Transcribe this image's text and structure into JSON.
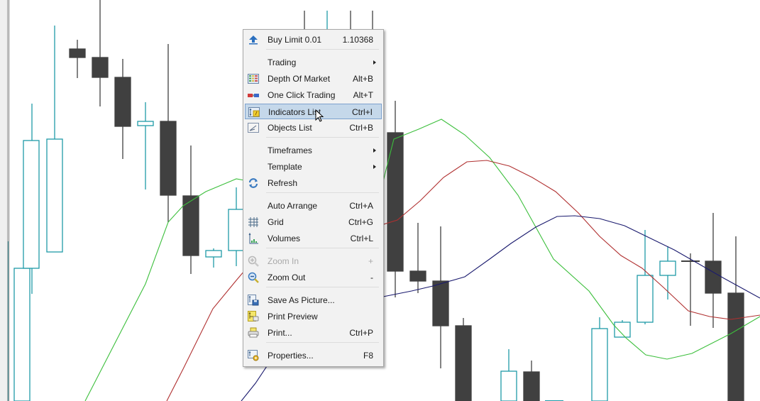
{
  "context_menu": {
    "items": [
      {
        "id": "buy-limit",
        "label": "Buy Limit 0.01",
        "shortcut": "1.10368",
        "icon": "buy-arrow-icon",
        "submenu": false,
        "disabled": false
      },
      {
        "id": "trading",
        "label": "Trading",
        "shortcut": "",
        "icon": "",
        "submenu": true,
        "disabled": false
      },
      {
        "id": "depth-of-market",
        "label": "Depth Of Market",
        "shortcut": "Alt+B",
        "icon": "depth-of-market-icon",
        "submenu": false,
        "disabled": false
      },
      {
        "id": "one-click-trading",
        "label": "One Click Trading",
        "shortcut": "Alt+T",
        "icon": "one-click-trading-icon",
        "submenu": false,
        "disabled": false
      },
      {
        "id": "indicators-list",
        "label": "Indicators List",
        "shortcut": "Ctrl+I",
        "icon": "indicators-list-icon",
        "submenu": false,
        "disabled": false,
        "highlighted": true
      },
      {
        "id": "objects-list",
        "label": "Objects List",
        "shortcut": "Ctrl+B",
        "icon": "objects-list-icon",
        "submenu": false,
        "disabled": false
      },
      {
        "id": "timeframes",
        "label": "Timeframes",
        "shortcut": "",
        "icon": "",
        "submenu": true,
        "disabled": false
      },
      {
        "id": "template",
        "label": "Template",
        "shortcut": "",
        "icon": "",
        "submenu": true,
        "disabled": false
      },
      {
        "id": "refresh",
        "label": "Refresh",
        "shortcut": "",
        "icon": "refresh-icon",
        "submenu": false,
        "disabled": false
      },
      {
        "id": "auto-arrange",
        "label": "Auto Arrange",
        "shortcut": "Ctrl+A",
        "icon": "",
        "submenu": false,
        "disabled": false
      },
      {
        "id": "grid",
        "label": "Grid",
        "shortcut": "Ctrl+G",
        "icon": "grid-icon",
        "submenu": false,
        "disabled": false
      },
      {
        "id": "volumes",
        "label": "Volumes",
        "shortcut": "Ctrl+L",
        "icon": "volumes-icon",
        "submenu": false,
        "disabled": false
      },
      {
        "id": "zoom-in",
        "label": "Zoom In",
        "shortcut": "+",
        "icon": "zoom-in-icon",
        "submenu": false,
        "disabled": true
      },
      {
        "id": "zoom-out",
        "label": "Zoom Out",
        "shortcut": "-",
        "icon": "zoom-out-icon",
        "submenu": false,
        "disabled": false
      },
      {
        "id": "save-as-picture",
        "label": "Save As Picture...",
        "shortcut": "",
        "icon": "save-picture-icon",
        "submenu": false,
        "disabled": false
      },
      {
        "id": "print-preview",
        "label": "Print Preview",
        "shortcut": "",
        "icon": "print-preview-icon",
        "submenu": false,
        "disabled": false
      },
      {
        "id": "print",
        "label": "Print...",
        "shortcut": "Ctrl+P",
        "icon": "printer-icon",
        "submenu": false,
        "disabled": false
      },
      {
        "id": "properties",
        "label": "Properties...",
        "shortcut": "F8",
        "icon": "properties-icon",
        "submenu": false,
        "disabled": false
      }
    ]
  },
  "chart": {
    "colors": {
      "bull": "#1f9aa8",
      "bear": "#404040",
      "ma_fast": "#3cbf3c",
      "ma_mid": "#b03030",
      "ma_slow": "#1a1a6e",
      "menu_highlight": "#c5d8ea"
    },
    "candles": [
      {
        "dir": "bull",
        "o": 0.2,
        "c": 0.55,
        "h": 0.75,
        "l": 0.0
      },
      {
        "dir": "bull",
        "o": 0.33,
        "c": 0.65,
        "h": 0.74,
        "l": 0.27
      },
      {
        "dir": "bull",
        "o": 0.65,
        "c": 0.94,
        "h": 0.95,
        "l": 0.6
      },
      {
        "dir": "bear",
        "o": 0.88,
        "c": 0.86,
        "h": 0.9,
        "l": 0.81
      },
      {
        "dir": "bear",
        "o": 0.86,
        "c": 0.81,
        "h": 1.0,
        "l": 0.76
      },
      {
        "dir": "bear",
        "o": 0.81,
        "c": 0.68,
        "h": 0.82,
        "l": 0.61
      },
      {
        "dir": "bull",
        "o": 0.69,
        "c": 0.7,
        "h": 0.75,
        "l": 0.53
      },
      {
        "dir": "bear",
        "o": 0.7,
        "c": 0.51,
        "h": 0.86,
        "l": 0.44
      },
      {
        "dir": "bear",
        "o": 0.51,
        "c": 0.36,
        "h": 0.63,
        "l": 0.32
      },
      {
        "dir": "bull",
        "o": 0.35,
        "c": 0.37,
        "h": 0.38,
        "l": 0.33
      },
      {
        "dir": "bull",
        "o": 0.34,
        "c": 0.48,
        "h": 0.53,
        "l": 0.32
      },
      {
        "dir": "bull",
        "o": 0.55,
        "c": 0.6,
        "h": 0.61,
        "l": 0.5
      },
      {
        "dir": "bull",
        "o": 0.4,
        "c": 0.52,
        "h": 0.6,
        "l": 0.38
      },
      {
        "dir": "bear",
        "o": 1.0,
        "c": 0.97,
        "h": 1.0,
        "l": 0.9
      },
      {
        "dir": "bear",
        "o": 1.0,
        "c": 0.98,
        "h": 1.0,
        "l": 0.9
      },
      {
        "dir": "bear",
        "o": 1.0,
        "c": 0.99,
        "h": 1.0,
        "l": 0.95
      },
      {
        "dir": "bear",
        "o": 0.68,
        "c": 0.32,
        "h": 0.76,
        "l": 0.28
      },
      {
        "dir": "bear",
        "o": 0.34,
        "c": 0.31,
        "h": 0.45,
        "l": 0.28
      },
      {
        "dir": "bear",
        "o": 0.3,
        "c": 0.19,
        "h": 0.44,
        "l": 0.09
      },
      {
        "dir": "bear",
        "o": 0.19,
        "c": -0.1,
        "h": 0.21,
        "l": -0.1
      },
      {
        "dir": "bull",
        "o": -0.1,
        "c": 0.05,
        "h": 0.13,
        "l": -0.1
      },
      {
        "dir": "bear",
        "o": 0.04,
        "c": -0.1,
        "h": 0.07,
        "l": -0.1
      },
      {
        "dir": "bull",
        "o": -0.1,
        "c": -0.05,
        "h": 0.0,
        "l": -0.1
      },
      {
        "dir": "bull",
        "o": -0.1,
        "c": 0.19,
        "h": 0.21,
        "l": -0.1
      },
      {
        "dir": "bull",
        "o": 0.16,
        "c": 0.2,
        "h": 0.21,
        "l": 0.15
      },
      {
        "dir": "bull",
        "o": 0.2,
        "c": 0.33,
        "h": 0.45,
        "l": 0.2
      },
      {
        "dir": "bull",
        "o": 0.36,
        "c": 0.4,
        "h": 0.43,
        "l": 0.28
      },
      {
        "dir": "bear",
        "o": 0.4,
        "c": 0.4,
        "h": 0.42,
        "l": 0.19
      },
      {
        "dir": "bear",
        "o": 0.4,
        "c": 0.32,
        "h": 0.52,
        "l": 0.19
      },
      {
        "dir": "bear",
        "o": 0.31,
        "c": -0.1,
        "h": 0.47,
        "l": -0.1
      }
    ],
    "ma_fast": [
      [
        -0.1,
        -0.1
      ],
      [
        4,
        -0.1
      ],
      [
        6,
        0.28
      ],
      [
        7,
        0.45
      ],
      [
        8,
        0.56
      ],
      [
        10,
        0.61
      ],
      [
        16,
        0.67
      ],
      [
        17,
        0.74
      ],
      [
        18,
        0.77
      ],
      [
        19,
        0.72
      ],
      [
        21,
        0.57
      ],
      [
        22,
        0.35
      ],
      [
        23,
        0.22
      ],
      [
        24,
        0.16
      ],
      [
        25,
        0.11
      ],
      [
        27,
        0.1
      ],
      [
        28,
        0.13
      ],
      [
        29,
        0.19
      ],
      [
        31,
        0.24
      ]
    ],
    "ma_mid": [
      [
        4,
        -0.1
      ],
      [
        6,
        0.05
      ],
      [
        8,
        0.25
      ],
      [
        10,
        0.34
      ],
      [
        16,
        0.45
      ],
      [
        17,
        0.52
      ],
      [
        18,
        0.57
      ],
      [
        19,
        0.62
      ],
      [
        20,
        0.62
      ],
      [
        21,
        0.59
      ],
      [
        22,
        0.55
      ],
      [
        24,
        0.45
      ],
      [
        25,
        0.36
      ],
      [
        26,
        0.32
      ],
      [
        27,
        0.25
      ],
      [
        28,
        0.21
      ],
      [
        29,
        0.2
      ],
      [
        31,
        0.24
      ]
    ],
    "ma_slow": [
      [
        9,
        -0.1
      ],
      [
        10,
        0.02
      ],
      [
        15,
        0.27
      ],
      [
        16,
        0.28
      ],
      [
        17,
        0.3
      ],
      [
        18,
        0.36
      ],
      [
        19,
        0.41
      ],
      [
        20,
        0.45
      ],
      [
        21,
        0.49
      ],
      [
        22,
        0.49
      ],
      [
        23,
        0.48
      ],
      [
        24,
        0.46
      ],
      [
        25,
        0.41
      ],
      [
        26,
        0.37
      ],
      [
        27,
        0.34
      ],
      [
        28,
        0.31
      ],
      [
        29,
        0.28
      ],
      [
        31,
        0.25
      ]
    ]
  }
}
